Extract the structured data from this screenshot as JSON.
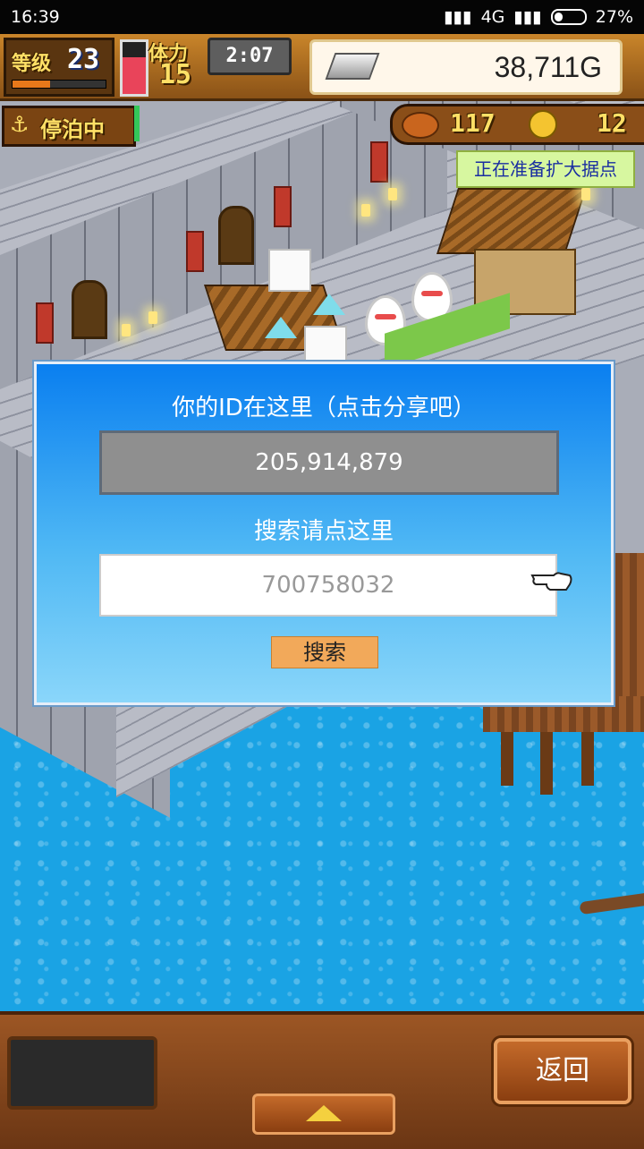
{
  "status_bar": {
    "time": "16:39",
    "network": "4G",
    "battery": "27%"
  },
  "hud": {
    "level_label": "等级",
    "level": "23",
    "stamina_label": "体力",
    "stamina": "15",
    "timer": "2:07",
    "gold": "38,711G",
    "docked_label": "停泊中",
    "food": "117",
    "coins": "12",
    "expansion_notice": "正在准备扩大据点"
  },
  "dialog": {
    "title": "你的ID在这里（点击分享吧）",
    "my_id": "205,914,879",
    "search_hint": "搜索请点这里",
    "search_placeholder": "700758032",
    "search_button": "搜索"
  },
  "bottom_bar": {
    "back_button": "返回"
  },
  "colors": {
    "dialog_top": "#0a7ff0",
    "dialog_bottom": "#8ad6fa",
    "search_button": "#f2a95a",
    "water": "#1aa3e4"
  }
}
